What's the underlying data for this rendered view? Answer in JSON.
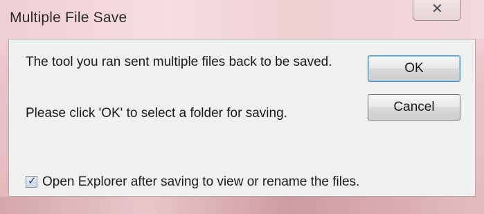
{
  "window": {
    "title": "Multiple File Save",
    "close_glyph": "✕"
  },
  "message": {
    "line1": "The tool you ran sent multiple files back to be saved.",
    "line2": "Please click 'OK' to select a folder for saving."
  },
  "buttons": {
    "ok_label": "OK",
    "cancel_label": "Cancel"
  },
  "option": {
    "checked": true,
    "check_glyph": "✓",
    "label": "Open Explorer after saving to view or rename the files."
  },
  "colors": {
    "accent": "#3c7fb1",
    "check_color": "#1f3d8a",
    "frame": "#e9c3c8",
    "client_bg": "#f0f0f0"
  },
  "icons": {
    "close": "close-icon",
    "checkbox": "checkmark-icon"
  }
}
